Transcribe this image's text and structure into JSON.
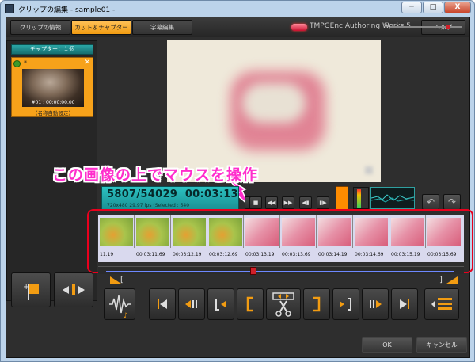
{
  "window": {
    "title": "クリップの編集 - sample01 -",
    "minimize": "─",
    "maximize": "□",
    "close": "X"
  },
  "tabs": [
    {
      "label": "クリップの情報",
      "active": false
    },
    {
      "label": "カット＆チャプター",
      "active": true
    },
    {
      "label": "字幕編集",
      "active": false
    }
  ],
  "brand": "TMPGEnc Authoring Works 5",
  "help_label": "ヘルプ",
  "chapter_panel": {
    "header": "チャプター：１個",
    "marker": "*",
    "timecode": "#01 : 00:00:00.00",
    "name": "（名称自動設定）"
  },
  "annotation": "この画像の上でマウスを操作",
  "timecode": {
    "frame": "5807/54029",
    "time": "00:03:13",
    "info": "720x480 29.97 fps (Selected : 540"
  },
  "timeline_labels": [
    "11.19",
    "00:03:11.69",
    "00:03:12.19",
    "00:03:12.69",
    "00:03:13.19",
    "00:03:13.69",
    "00:03:14.19",
    "00:03:14.69",
    "00:03:15.19",
    "00:03:15.69"
  ],
  "timeline_thumbs": [
    "lime",
    "lime",
    "lime",
    "lime",
    "pink",
    "pink",
    "pink",
    "pink",
    "pink",
    "pink"
  ],
  "selection_bracket_left": "[",
  "selection_bracket_right": "]",
  "ok_label": "OK",
  "cancel_label": "キャンセル",
  "colors": {
    "accent": "#f29c12",
    "timecode_bg": "#1a8f92",
    "highlight": "#e9001d",
    "annotation": "#ff2dcc",
    "seek": "#6d88ff"
  }
}
